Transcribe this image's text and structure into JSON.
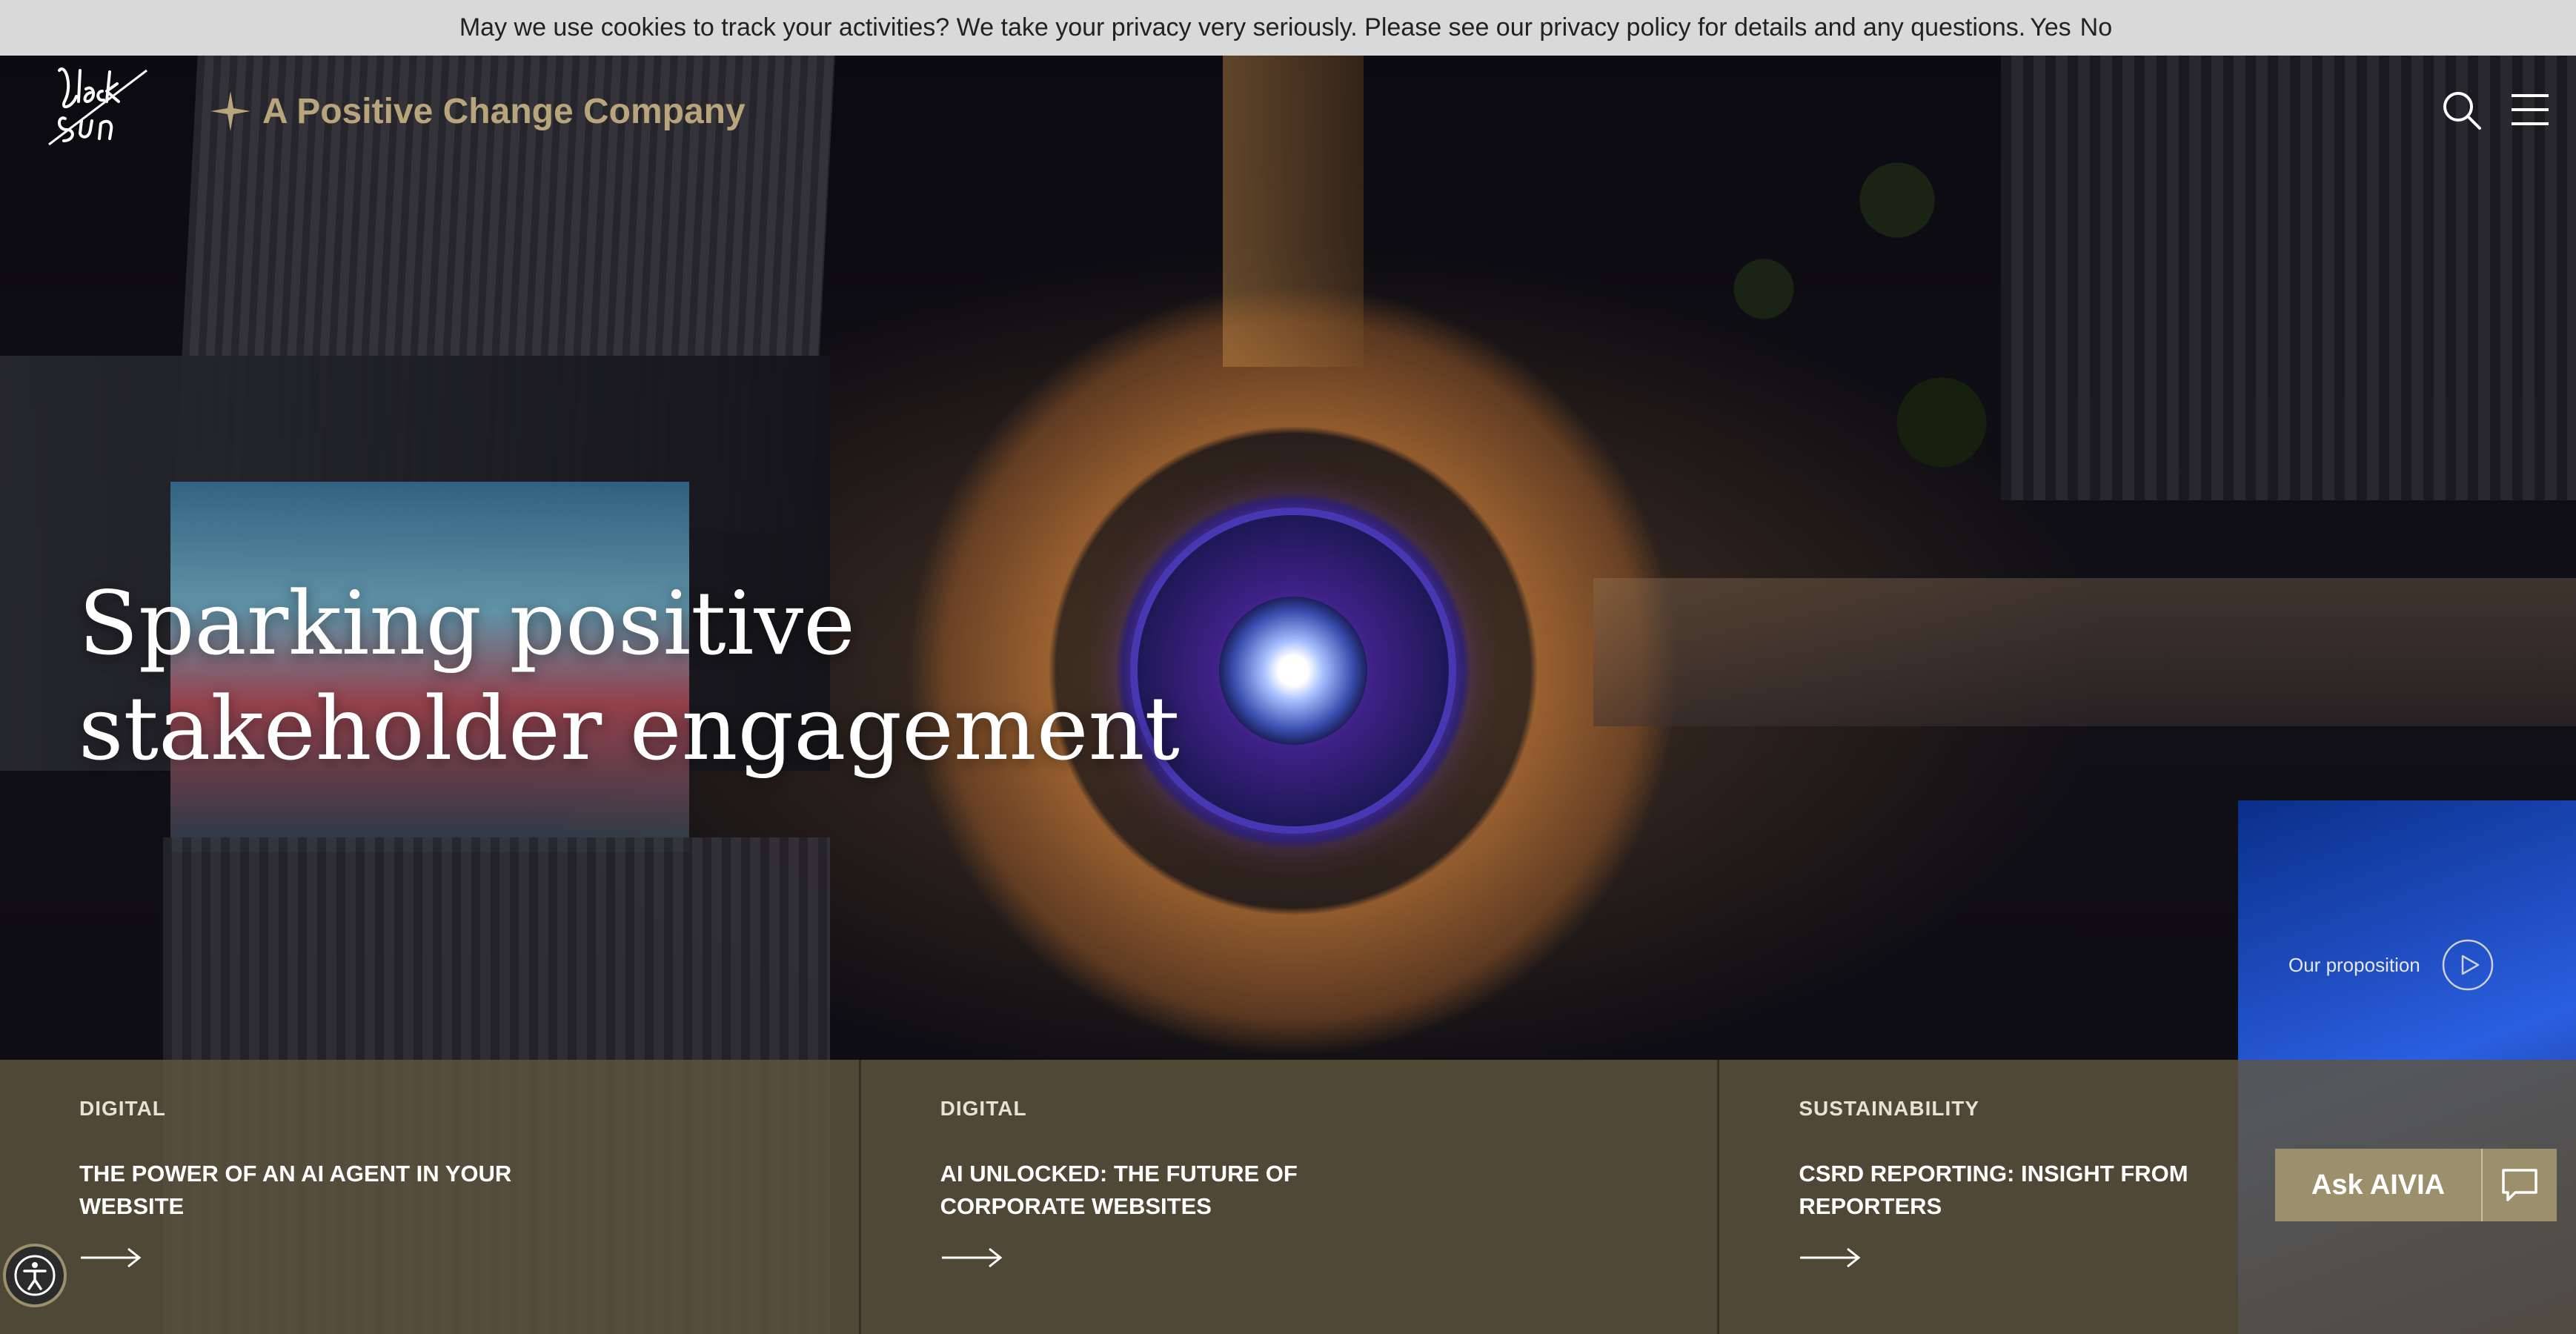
{
  "cookie_banner": {
    "message": "May we use cookies to track your activities? We take your privacy very seriously. Please see our privacy policy for details and any questions.",
    "yes_label": "Yes",
    "no_label": "No"
  },
  "header": {
    "logo_text": "Black Sun",
    "tagline": "A Positive Change Company",
    "icons": [
      "search-icon",
      "hamburger-menu-icon"
    ]
  },
  "hero": {
    "headline_line1": "Sparking positive",
    "headline_line2": "stakeholder engagement",
    "proposition_label": "Our proposition"
  },
  "cards": [
    {
      "category": "DIGITAL",
      "title": "THE POWER OF AN AI AGENT IN YOUR WEBSITE"
    },
    {
      "category": "DIGITAL",
      "title": "AI UNLOCKED: THE FUTURE OF CORPORATE WEBSITES"
    },
    {
      "category": "SUSTAINABILITY",
      "title": "CSRD REPORTING: INSIGHT FROM REPORTERS"
    }
  ],
  "chat_widget": {
    "label": "Ask AIVIA",
    "icon": "chat-bubble-icon"
  },
  "accessibility": {
    "icon": "accessibility-icon"
  },
  "colors": {
    "brand_gold": "#b8a57c",
    "card_bar": "#5f563e",
    "aivia_button": "#9c8f6c",
    "cookie_bar": "#d9d9d9"
  }
}
